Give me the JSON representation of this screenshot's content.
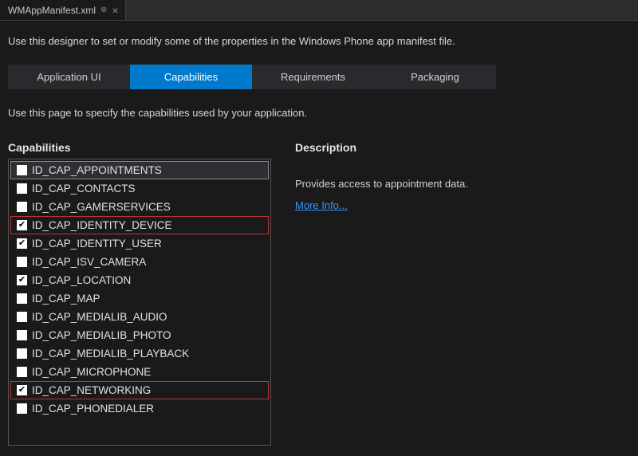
{
  "fileTab": {
    "name": "WMAppManifest.xml"
  },
  "intro": "Use this designer to set or modify some of the properties in the Windows Phone app manifest file.",
  "navTabs": [
    {
      "label": "Application UI",
      "active": false
    },
    {
      "label": "Capabilities",
      "active": true
    },
    {
      "label": "Requirements",
      "active": false
    },
    {
      "label": "Packaging",
      "active": false
    }
  ],
  "pageDesc": "Use this page to specify the capabilities used by your application.",
  "capabilitiesHeading": "Capabilities",
  "capabilities": [
    {
      "id": "ID_CAP_APPOINTMENTS",
      "checked": false,
      "selected": true,
      "highlighted": false
    },
    {
      "id": "ID_CAP_CONTACTS",
      "checked": false,
      "selected": false,
      "highlighted": false
    },
    {
      "id": "ID_CAP_GAMERSERVICES",
      "checked": false,
      "selected": false,
      "highlighted": false
    },
    {
      "id": "ID_CAP_IDENTITY_DEVICE",
      "checked": true,
      "selected": false,
      "highlighted": true
    },
    {
      "id": "ID_CAP_IDENTITY_USER",
      "checked": true,
      "selected": false,
      "highlighted": false
    },
    {
      "id": "ID_CAP_ISV_CAMERA",
      "checked": false,
      "selected": false,
      "highlighted": false
    },
    {
      "id": "ID_CAP_LOCATION",
      "checked": true,
      "selected": false,
      "highlighted": false
    },
    {
      "id": "ID_CAP_MAP",
      "checked": false,
      "selected": false,
      "highlighted": false
    },
    {
      "id": "ID_CAP_MEDIALIB_AUDIO",
      "checked": false,
      "selected": false,
      "highlighted": false
    },
    {
      "id": "ID_CAP_MEDIALIB_PHOTO",
      "checked": false,
      "selected": false,
      "highlighted": false
    },
    {
      "id": "ID_CAP_MEDIALIB_PLAYBACK",
      "checked": false,
      "selected": false,
      "highlighted": false
    },
    {
      "id": "ID_CAP_MICROPHONE",
      "checked": false,
      "selected": false,
      "highlighted": false
    },
    {
      "id": "ID_CAP_NETWORKING",
      "checked": true,
      "selected": false,
      "highlighted": true
    },
    {
      "id": "ID_CAP_PHONEDIALER",
      "checked": false,
      "selected": false,
      "highlighted": false
    }
  ],
  "descriptionHeading": "Description",
  "descriptionText": "Provides access to appointment data.",
  "moreInfoLabel": "More Info..."
}
